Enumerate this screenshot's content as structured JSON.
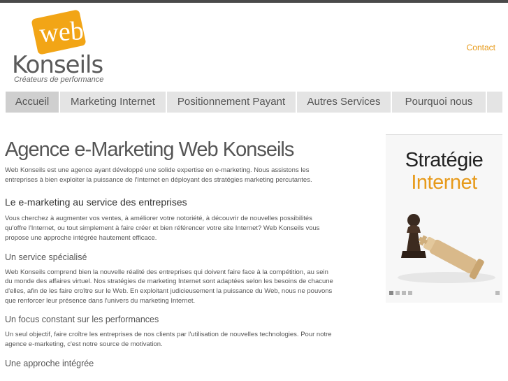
{
  "logo": {
    "badge_text": "web",
    "name": "Konseils",
    "tagline": "Créateurs de performance"
  },
  "header": {
    "contact_label": "Contact"
  },
  "nav": {
    "items": [
      {
        "label": "Accueil",
        "active": true
      },
      {
        "label": "Marketing Internet",
        "active": false
      },
      {
        "label": "Positionnement Payant",
        "active": false
      },
      {
        "label": "Autres Services",
        "active": false
      },
      {
        "label": "Pourquoi nous",
        "active": false
      }
    ]
  },
  "main": {
    "title": "Agence e-Marketing Web Konseils",
    "intro": "Web Konseils est une agence ayant développé une solide expertise en e-marketing. Nous assistons les entreprises à bien exploiter la puissance de l'Internet en déployant des stratégies marketing percutantes.",
    "section1": {
      "heading": "Le e-marketing au service des entreprises",
      "text": "Vous cherchez à augmenter vos ventes, à améliorer votre notoriété, à découvrir de nouvelles possibilités qu'offre l'Internet, ou tout simplement à faire créer et bien référencer votre site Internet? Web Konseils vous propose une approche intégrée hautement efficace."
    },
    "section2": {
      "heading": "Un service spécialisé",
      "text": "Web Konseils comprend bien la nouvelle réalité des entreprises qui doivent faire face à la compétition, au sein du monde des affaires virtuel. Nos stratégies de marketing Internet sont adaptées selon les besoins de chacune d'elles, afin de les faire croître sur le Web. En exploitant judicieusement la puissance du Web, nous ne pouvons que renforcer leur présence dans l'univers du marketing Internet."
    },
    "section3": {
      "heading": "Un focus constant sur les performances",
      "text": "Un seul objectif, faire croître les entreprises de nos clients par l'utilisation de nouvelles technologies. Pour notre agence e-marketing, c'est notre source de motivation."
    },
    "section4": {
      "heading": "Une approche intégrée"
    }
  },
  "slider": {
    "title_line1": "Stratégie",
    "title_line2": "Internet",
    "slide_count": 4,
    "active_slide": 1
  },
  "colors": {
    "accent": "#e79a1a",
    "nav_bg": "#e4e4e4",
    "nav_active_bg": "#cfcfcf",
    "topbar": "#4a4a4a"
  }
}
